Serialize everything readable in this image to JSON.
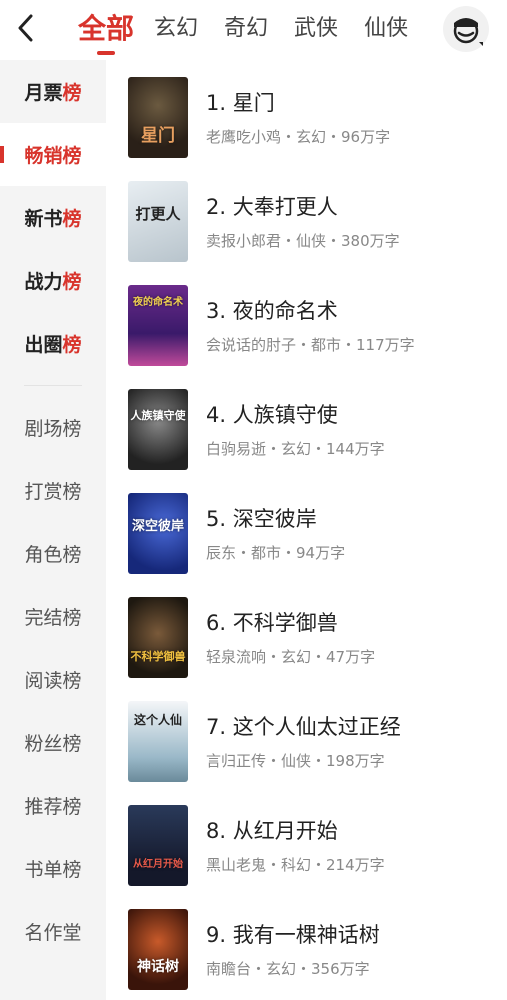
{
  "tabs": [
    "全部",
    "玄幻",
    "奇幻",
    "武侠",
    "仙侠"
  ],
  "sidebar": [
    {
      "prefix": "月票",
      "accent": "榜"
    },
    {
      "prefix": "畅销",
      "accent": "榜"
    },
    {
      "prefix": "新书",
      "accent": "榜"
    },
    {
      "prefix": "战力",
      "accent": "榜"
    },
    {
      "prefix": "出圈",
      "accent": "榜"
    },
    {
      "label": "剧场榜"
    },
    {
      "label": "打赏榜"
    },
    {
      "label": "角色榜"
    },
    {
      "label": "完结榜"
    },
    {
      "label": "阅读榜"
    },
    {
      "label": "粉丝榜"
    },
    {
      "label": "推荐榜"
    },
    {
      "label": "书单榜"
    },
    {
      "label": "名作堂"
    }
  ],
  "books": [
    {
      "title": "1. 星门",
      "meta": "老鹰吃小鸡・玄幻・96万字",
      "cover_text": "星门"
    },
    {
      "title": "2. 大奉打更人",
      "meta": "卖报小郎君・仙侠・380万字",
      "cover_text": "打更人"
    },
    {
      "title": "3. 夜的命名术",
      "meta": "会说话的肘子・都市・117万字",
      "cover_text": "夜的命名术"
    },
    {
      "title": "4. 人族镇守使",
      "meta": "白驹易逝・玄幻・144万字",
      "cover_text": "人族镇守使"
    },
    {
      "title": "5. 深空彼岸",
      "meta": "辰东・都市・94万字",
      "cover_text": "深空彼岸"
    },
    {
      "title": "6. 不科学御兽",
      "meta": "轻泉流响・玄幻・47万字",
      "cover_text": "不科学御兽"
    },
    {
      "title": "7. 这个人仙太过正经",
      "meta": "言归正传・仙侠・198万字",
      "cover_text": "这个人仙"
    },
    {
      "title": "8. 从红月开始",
      "meta": "黑山老鬼・科幻・214万字",
      "cover_text": "从红月开始"
    },
    {
      "title": "9. 我有一棵神话树",
      "meta": "南瞻台・玄幻・356万字",
      "cover_text": "神话树"
    }
  ]
}
